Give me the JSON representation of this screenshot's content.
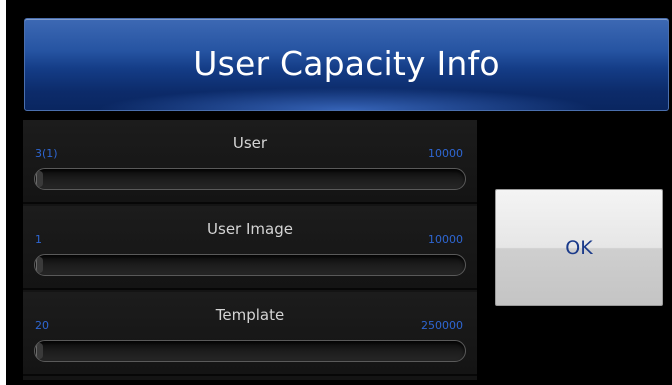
{
  "dialog": {
    "title": "User Capacity Info"
  },
  "rows": [
    {
      "label": "User",
      "current": "3(1)",
      "max": "10000",
      "fill_fraction": 0.0003
    },
    {
      "label": "User Image",
      "current": "1",
      "max": "10000",
      "fill_fraction": 0.0001
    },
    {
      "label": "Template",
      "current": "20",
      "max": "250000",
      "fill_fraction": 0.0001
    }
  ],
  "ok_button": {
    "label": "OK"
  },
  "colors": {
    "title_bar": "#1c468f",
    "value_text": "#2e66d2",
    "label_text": "#d4d4d4",
    "button_text": "#1a3a8a",
    "background": "#000000"
  }
}
